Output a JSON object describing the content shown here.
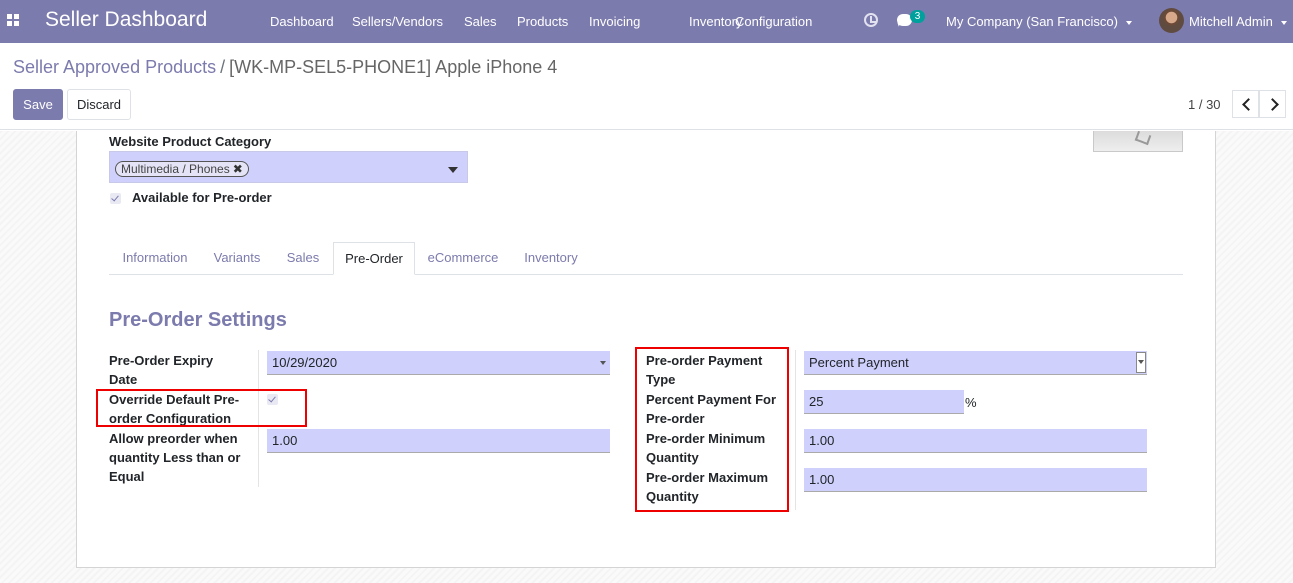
{
  "navbar": {
    "brand": "Seller Dashboard",
    "menus": [
      "Dashboard",
      "Sellers/Vendors",
      "Sales",
      "Products",
      "Invoicing",
      "Inventory",
      "Configuration"
    ],
    "message_count": "3",
    "company": "My Company (San Francisco)",
    "user": "Mitchell Admin"
  },
  "breadcrumb": {
    "parent": "Seller Approved Products",
    "separator": "/",
    "current": "[WK-MP-SEL5-PHONE1] Apple iPhone 4"
  },
  "actions": {
    "save": "Save",
    "discard": "Discard"
  },
  "pager": {
    "value": "1 / 30"
  },
  "form": {
    "website_category_label": "Website Product Category",
    "website_category_tag": "Multimedia / Phones",
    "available_preorder_label": "Available for Pre-order",
    "available_preorder_checked": true
  },
  "tabs": [
    "Information",
    "Variants",
    "Sales",
    "Pre-Order",
    "eCommerce",
    "Inventory"
  ],
  "active_tab": "Pre-Order",
  "preorder": {
    "section_title": "Pre-Order Settings",
    "expiry_label_1": "Pre-Order Expiry",
    "expiry_label_2": "Date",
    "expiry_value": "10/29/2020",
    "override_label_1": "Override Default Pre-",
    "override_label_2": "order Configuration",
    "override_checked": true,
    "allow_label_1": "Allow preorder when",
    "allow_label_2": "quantity Less than or",
    "allow_label_3": "Equal",
    "allow_value": "1.00",
    "payment_type_label_1": "Pre-order Payment",
    "payment_type_label_2": "Type",
    "payment_type_value": "Percent Payment",
    "percent_label_1": "Percent Payment For",
    "percent_label_2": "Pre-order",
    "percent_value": "25",
    "percent_suffix": "%",
    "min_label_1": "Pre-order Minimum",
    "min_label_2": "Quantity",
    "min_value": "1.00",
    "max_label_1": "Pre-order Maximum",
    "max_label_2": "Quantity",
    "max_value": "1.00"
  },
  "colors": {
    "brand": "#7c7bad",
    "input_bg": "#cfd0fb",
    "highlight": "#e00000",
    "badge": "#00a09d"
  }
}
